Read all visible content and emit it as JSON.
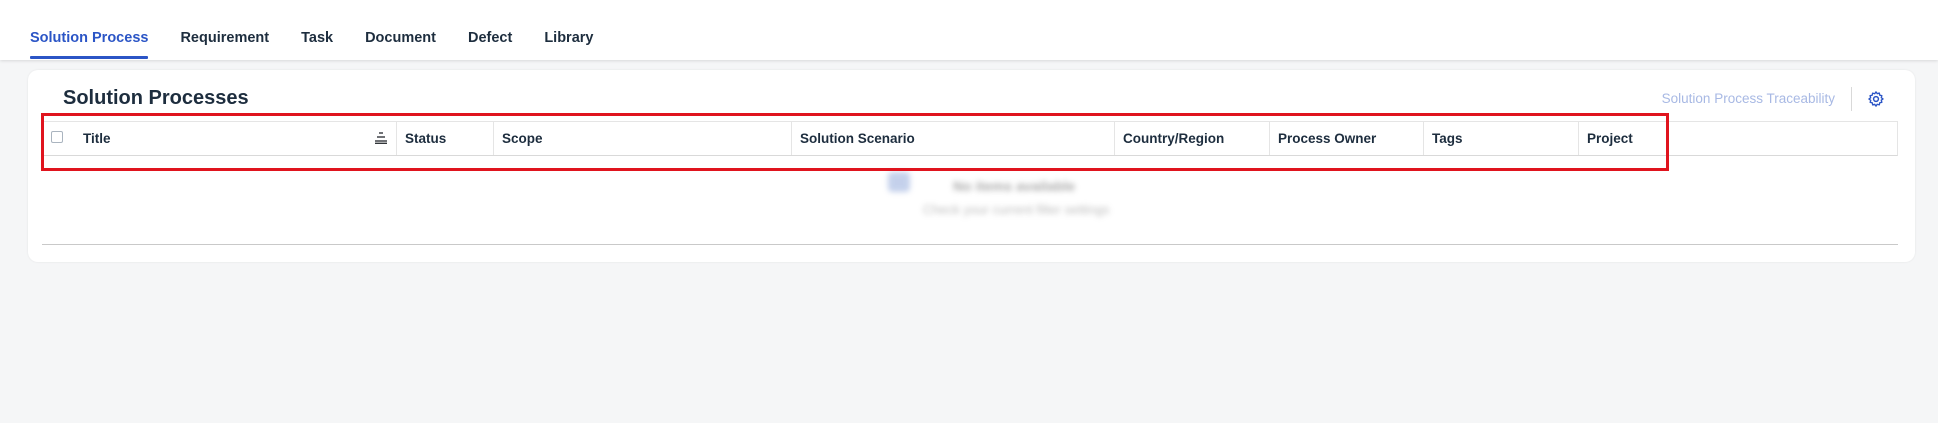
{
  "tabs": [
    {
      "label": "Solution Process",
      "active": true
    },
    {
      "label": "Requirement",
      "active": false
    },
    {
      "label": "Task",
      "active": false
    },
    {
      "label": "Document",
      "active": false
    },
    {
      "label": "Defect",
      "active": false
    },
    {
      "label": "Library",
      "active": false
    }
  ],
  "card": {
    "title": "Solution Processes",
    "traceability_link": "Solution Process Traceability",
    "settings_icon": "gear-icon"
  },
  "table": {
    "columns": [
      "Title",
      "Status",
      "Scope",
      "Solution Scenario",
      "Country/Region",
      "Process Owner",
      "Tags",
      "Project"
    ],
    "sort_icon": "sort-icon",
    "empty_title": "No items available",
    "empty_hint": "Check your current filter settings"
  },
  "colors": {
    "accent": "#2b55c6",
    "highlight": "#e0141e",
    "link_disabled": "#a8b9e4"
  }
}
